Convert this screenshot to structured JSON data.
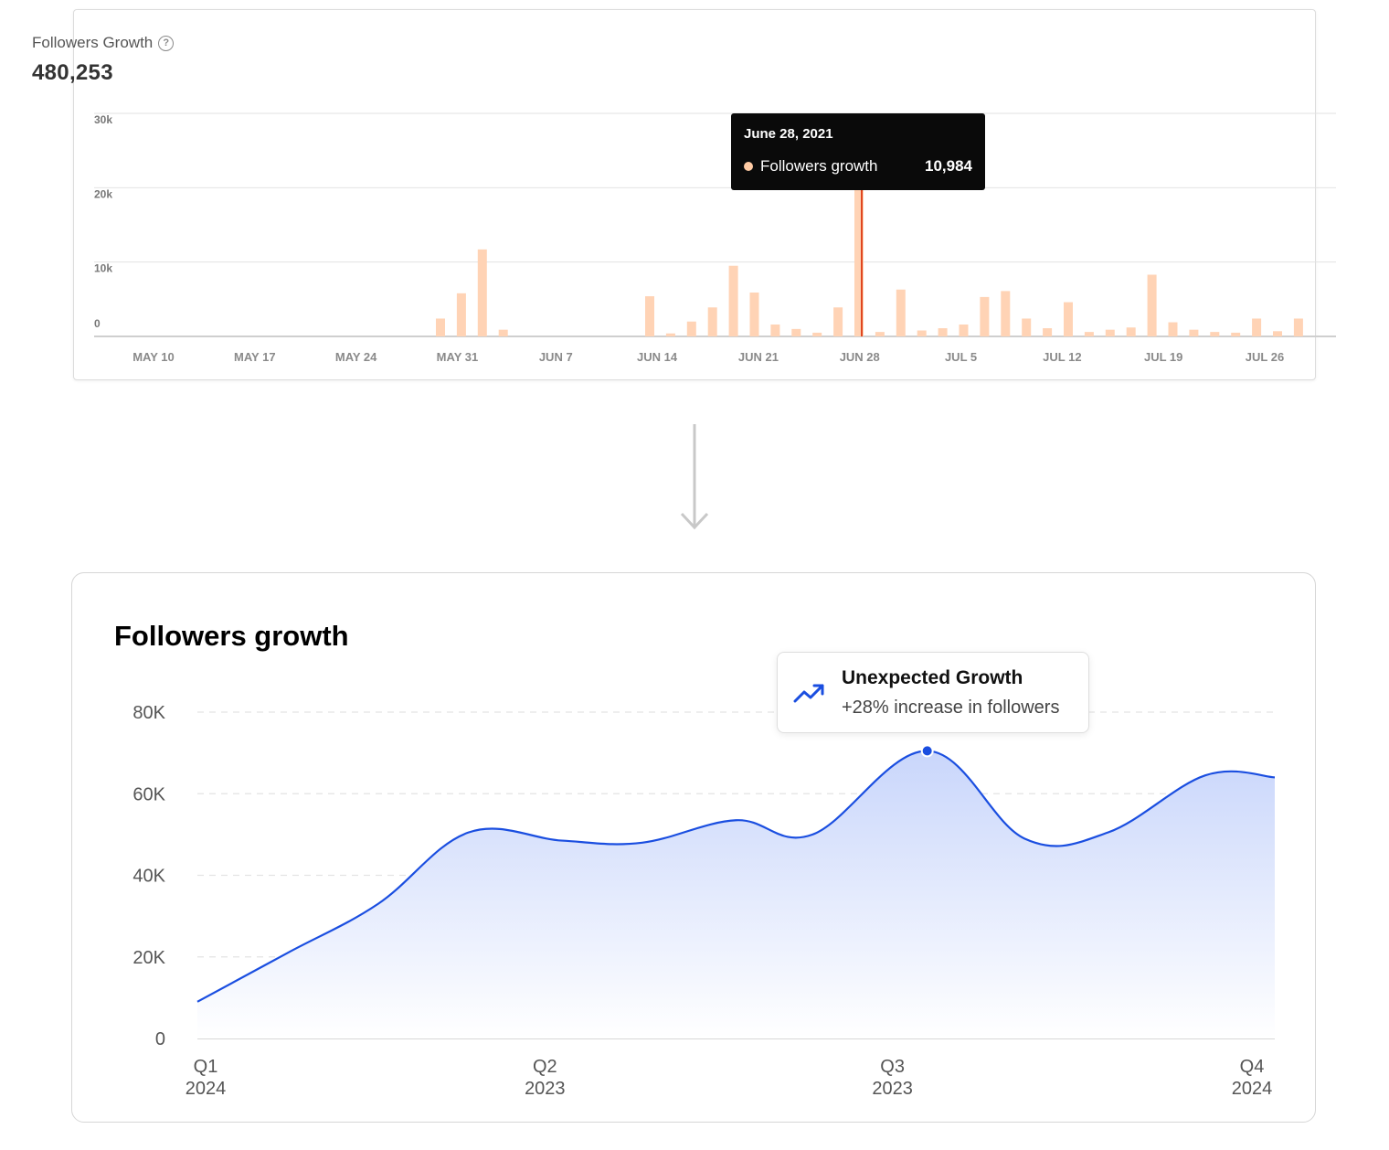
{
  "top_card": {
    "title": "Followers Growth",
    "help_icon": "question-circle-icon",
    "total": "480,253",
    "tooltip": {
      "date": "June 28, 2021",
      "label": "Followers growth",
      "value": "10,984"
    }
  },
  "bottom_card": {
    "title": "Followers growth",
    "annotation": {
      "icon": "trending-up-icon",
      "title": "Unexpected Growth",
      "subtitle": "+28% increase in followers"
    }
  },
  "colors": {
    "bar": "#ffd3b5",
    "bar_highlight": "#f3c1a1",
    "highlight_line": "#e0461f",
    "area_line": "#1a4ee0",
    "area_fill_top": "#c9d6fb",
    "area_fill_bottom": "#ffffff",
    "gridline": "#e2e2e2",
    "annotation_icon": "#1a4ee0"
  },
  "chart_data": [
    {
      "type": "bar",
      "title": "Followers Growth",
      "ylim": [
        0,
        30000
      ],
      "y_ticks": [
        0,
        10000,
        20000,
        30000
      ],
      "y_tick_labels": [
        "0",
        "10k",
        "20k",
        "30k"
      ],
      "x_tick_labels": [
        "MAY 10",
        "MAY 17",
        "MAY 24",
        "MAY 31",
        "JUN 7",
        "JUN 14",
        "JUN 21",
        "JUN 28",
        "JUL 5",
        "JUL 12",
        "JUL 19",
        "JUL 26"
      ],
      "highlight_category": "JUN 28",
      "series": [
        {
          "name": "Followers growth",
          "bars": [
            {
              "date": "May 30",
              "value": 2400
            },
            {
              "date": "May 31",
              "value": 5800
            },
            {
              "date": "Jun 1",
              "value": 11700
            },
            {
              "date": "Jun 2",
              "value": 900
            },
            {
              "date": "Jun 8",
              "value": 5400
            },
            {
              "date": "Jun 9",
              "value": 400
            },
            {
              "date": "Jun 11",
              "value": 2000
            },
            {
              "date": "Jun 12",
              "value": 3900
            },
            {
              "date": "Jun 13",
              "value": 9500
            },
            {
              "date": "Jun 14",
              "value": 5900
            },
            {
              "date": "Jun 15",
              "value": 1600
            },
            {
              "date": "Jun 16",
              "value": 1000
            },
            {
              "date": "Jun 17",
              "value": 500
            },
            {
              "date": "Jun 18",
              "value": 3900
            },
            {
              "date": "Jun 19",
              "value": 20000
            },
            {
              "date": "Jun 20",
              "value": 600
            },
            {
              "date": "Jun 21",
              "value": 6300
            },
            {
              "date": "Jun 22",
              "value": 800
            },
            {
              "date": "Jun 23",
              "value": 1100
            },
            {
              "date": "Jun 24",
              "value": 1600
            },
            {
              "date": "Jun 25",
              "value": 5300
            },
            {
              "date": "Jun 26",
              "value": 6100
            },
            {
              "date": "Jun 27",
              "value": 2400
            },
            {
              "date": "Jun 28",
              "value": 1100
            },
            {
              "date": "Jun 29",
              "value": 4600
            },
            {
              "date": "Jun 30",
              "value": 600
            },
            {
              "date": "Jul 1",
              "value": 900
            },
            {
              "date": "Jul 2",
              "value": 1200
            },
            {
              "date": "Jul 3",
              "value": 8300
            },
            {
              "date": "Jul 4",
              "value": 1900
            },
            {
              "date": "Jul 5",
              "value": 900
            },
            {
              "date": "Jul 6",
              "value": 600
            },
            {
              "date": "Jul 7",
              "value": 500
            },
            {
              "date": "Jul 8",
              "value": 2400
            },
            {
              "date": "Jul 9",
              "value": 700
            },
            {
              "date": "Jul 10",
              "value": 2400
            }
          ]
        }
      ]
    },
    {
      "type": "area",
      "title": "Followers growth",
      "ylim": [
        0,
        80000
      ],
      "y_ticks": [
        0,
        20000,
        40000,
        60000,
        80000
      ],
      "y_tick_labels": [
        "0",
        "20K",
        "40K",
        "60K",
        "80K"
      ],
      "x_ticks": [
        {
          "quarter": "Q1",
          "year": "2024",
          "x": 0
        },
        {
          "quarter": "Q2",
          "year": "2023",
          "x": 1
        },
        {
          "quarter": "Q3",
          "year": "2023",
          "x": 2
        },
        {
          "quarter": "Q4",
          "year": "2024",
          "x": 3
        }
      ],
      "xlim": [
        0,
        3.1
      ],
      "series": [
        {
          "points": [
            {
              "x": 0.0,
              "y": 9000
            },
            {
              "x": 0.26,
              "y": 21000
            },
            {
              "x": 0.52,
              "y": 33000
            },
            {
              "x": 0.78,
              "y": 50500
            },
            {
              "x": 1.05,
              "y": 48500
            },
            {
              "x": 1.28,
              "y": 48000
            },
            {
              "x": 1.55,
              "y": 53500
            },
            {
              "x": 1.77,
              "y": 50000
            },
            {
              "x": 2.1,
              "y": 70500
            },
            {
              "x": 2.38,
              "y": 49000
            },
            {
              "x": 2.62,
              "y": 50500
            },
            {
              "x": 2.9,
              "y": 64500
            },
            {
              "x": 3.1,
              "y": 64000
            }
          ]
        }
      ],
      "highlight_point": {
        "x": 2.1,
        "y": 70500
      }
    }
  ]
}
